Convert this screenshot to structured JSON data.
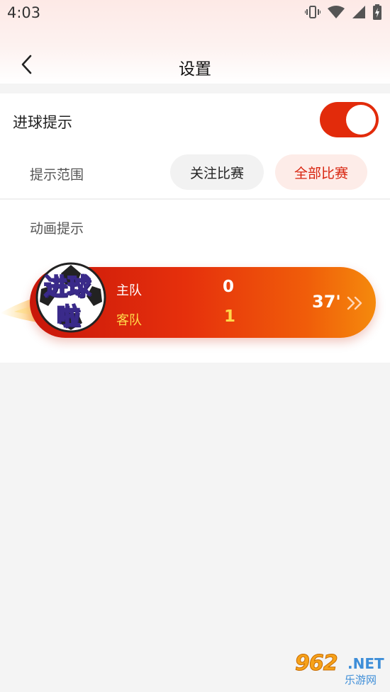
{
  "status_bar": {
    "time": "4:03"
  },
  "header": {
    "title": "设置"
  },
  "settings": {
    "goal_notify_label": "进球提示",
    "goal_notify_enabled": true,
    "scope_label": "提示范围",
    "scope_options": [
      "关注比赛",
      "全部比赛"
    ],
    "scope_selected": "全部比赛",
    "animation_label": "动画提示"
  },
  "goal_banner": {
    "badge_text_1": "进球",
    "badge_text_2": "啦",
    "home_label": "主队",
    "away_label": "客队",
    "home_score": "0",
    "away_score": "1",
    "minute": "37'"
  },
  "watermark": {
    "main": "962",
    "suffix": ".NET",
    "sub": "乐游网"
  },
  "colors": {
    "accent": "#e22b0b",
    "selected_pill_bg": "#fdece8",
    "selected_pill_text": "#d8240e",
    "away_text": "#ffd84a"
  }
}
